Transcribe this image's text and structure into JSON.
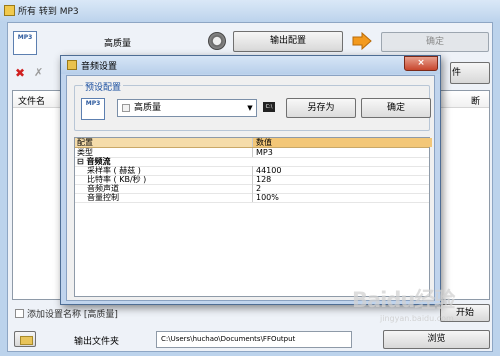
{
  "main_window": {
    "title": "所有 转到 MP3",
    "quality_label": "高质量",
    "output_config_label": "输出配置",
    "ok_label": "确定",
    "right_button_partial": "件",
    "file_list": {
      "column_filename": "文件名",
      "column_right_partial": "断"
    },
    "add_setting_label": "添加设置名称 [高质量]",
    "start_button_partial": "开始",
    "output_folder_label": "输出文件夹",
    "output_path": "C:\\Users\\huchao\\Documents\\FFOutput",
    "browse_label": "浏览"
  },
  "dialog": {
    "title": "音频设置",
    "close_glyph": "×",
    "preset_group_label": "预设配置",
    "preset_value": "高质量",
    "save_as_label": "另存为",
    "ok_label": "确定",
    "grid": {
      "header_name": "配置",
      "header_value": "数值",
      "type_name": "类型",
      "type_value": "MP3",
      "section_audio": "音频流",
      "rows": [
        {
          "name": "采样率 ( 赫兹 )",
          "value": "44100"
        },
        {
          "name": "比特率 ( KB/秒 )",
          "value": "128"
        },
        {
          "name": "音频声道",
          "value": "2"
        },
        {
          "name": "音量控制",
          "value": "100%"
        }
      ]
    }
  },
  "watermark": {
    "logo_text": "Baidu经验",
    "url": "jingyan.baidu.com"
  },
  "icons": {
    "section_expander": "⊟",
    "dropdown_arrow": "▼",
    "delete": "✖",
    "clear": "✗",
    "mp3_file_label": "MP3",
    "cmd_label": "C:\\"
  },
  "colors": {
    "title_gradient": "#bcd3ec",
    "close_button": "#c7462d",
    "grid_header": "#f3c778",
    "arrow_orange": "#f39a1e"
  }
}
